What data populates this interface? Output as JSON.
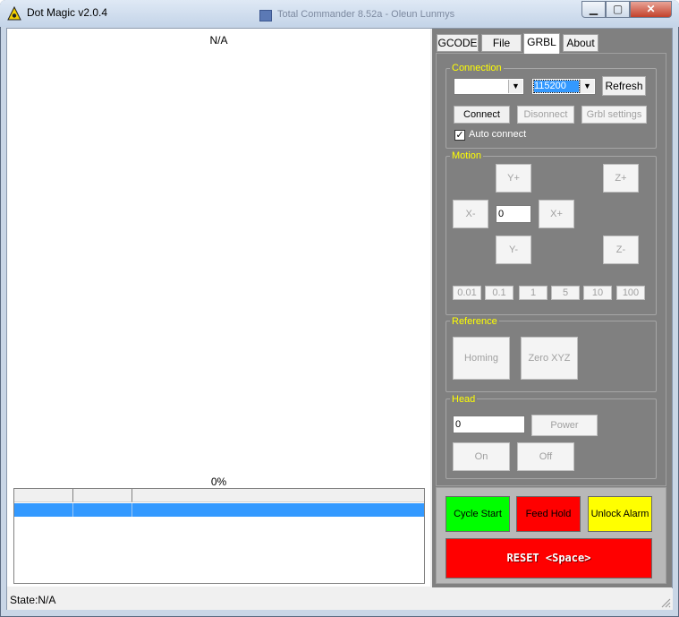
{
  "window": {
    "title": "Dot Magic v2.0.4",
    "background_title": "Total Commander 8.52a - Oleun Lunmys",
    "minimize_glyph": "▁",
    "maximize_glyph": "▢",
    "close_glyph": "✕"
  },
  "preview": {
    "title": "N/A",
    "progress": "0%"
  },
  "status": {
    "text": "State:N/A"
  },
  "tabs": [
    {
      "label": "GCODE"
    },
    {
      "label": "File"
    },
    {
      "label": "GRBL",
      "active": true
    },
    {
      "label": "About"
    }
  ],
  "connection": {
    "title": "Connection",
    "port_value": "",
    "baud_value": "115200",
    "refresh_label": "Refresh",
    "connect_label": "Connect",
    "disconnect_label": "Disonnect",
    "grbl_settings_label": "Grbl settings",
    "auto_connect_label": "Auto connect",
    "auto_connect_checked": true
  },
  "motion": {
    "title": "Motion",
    "y_plus": "Y+",
    "y_minus": "Y-",
    "x_plus": "X+",
    "x_minus": "X-",
    "z_plus": "Z+",
    "z_minus": "Z-",
    "step_value": "0",
    "steps": [
      "0.01",
      "0.1",
      "1",
      "5",
      "10",
      "100"
    ]
  },
  "reference": {
    "title": "Reference",
    "homing_label": "Homing",
    "zero_label": "Zero XYZ"
  },
  "head": {
    "title": "Head",
    "power_value": "0",
    "power_label": "Power",
    "on_label": "On",
    "off_label": "Off"
  },
  "controls": {
    "cycle_start_label": "Cycle Start",
    "feed_hold_label": "Feed Hold",
    "unlock_label": "Unlock Alarm",
    "reset_label": "RESET <Space>",
    "cycle_start_color": "#00ff00",
    "feed_hold_color": "#ff0000",
    "unlock_color": "#ffff00",
    "reset_color": "#ff0000"
  },
  "colors": {
    "panel": "#808080",
    "group_title": "#ffff00",
    "selection": "#3399ff"
  }
}
